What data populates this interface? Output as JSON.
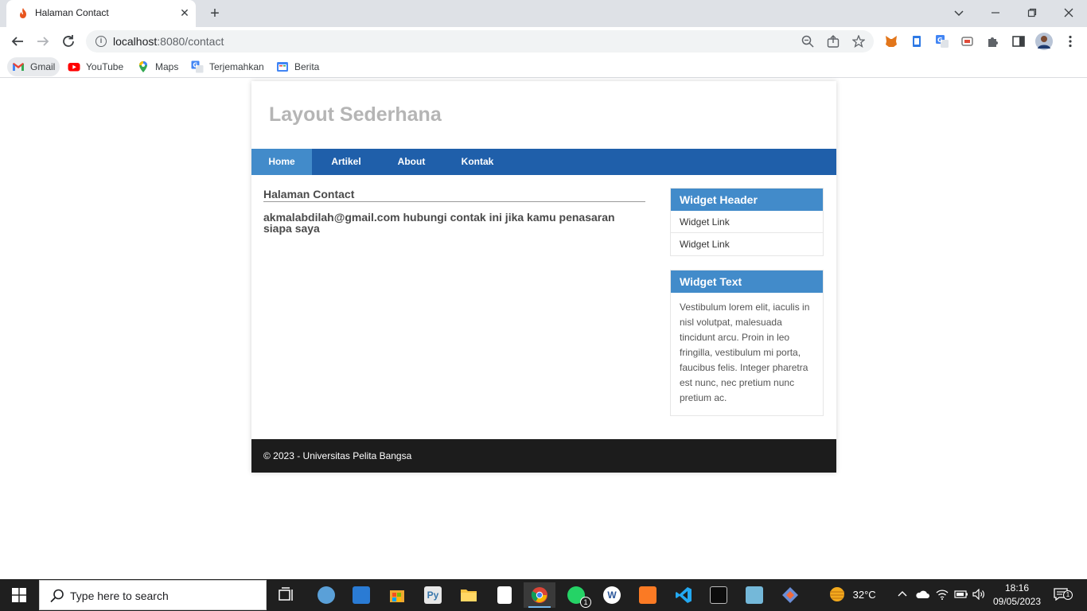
{
  "browser": {
    "tab_title": "Halaman Contact",
    "tab_close": "✕",
    "new_tab": "+",
    "url_host": "localhost",
    "url_rest": ":8080/contact",
    "bookmarks": [
      {
        "label": "Gmail"
      },
      {
        "label": "YouTube"
      },
      {
        "label": "Maps"
      },
      {
        "label": "Terjemahkan"
      },
      {
        "label": "Berita"
      }
    ]
  },
  "site": {
    "title": "Layout Sederhana",
    "nav": [
      {
        "label": "Home",
        "active": true
      },
      {
        "label": "Artikel"
      },
      {
        "label": "About"
      },
      {
        "label": "Kontak"
      }
    ],
    "content": {
      "heading": "Halaman Contact",
      "body": "akmalabdilah@gmail.com hubungi contak ini jika kamu penasaran siapa saya"
    },
    "sidebar": {
      "widget1": {
        "header": "Widget Header",
        "links": [
          "Widget Link",
          "Widget Link"
        ]
      },
      "widget2": {
        "header": "Widget Text",
        "text": "Vestibulum lorem elit, iaculis in nisl volutpat, malesuada tincidunt arcu. Proin in leo fringilla, vestibulum mi porta, faucibus felis. Integer pharetra est nunc, nec pretium nunc pretium ac."
      }
    },
    "footer": "© 2023 - Universitas Pelita Bangsa"
  },
  "taskbar": {
    "search_placeholder": "Type here to search",
    "weather": "32°C",
    "time": "18:16",
    "date": "09/05/2023",
    "whatsapp_badge": "1",
    "notification_badge": "1"
  },
  "colors": {
    "nav_bg": "#1f5faa",
    "nav_active": "#428bca",
    "widget_head": "#428bca",
    "footer_bg": "#1c1c1c",
    "title_gray": "#b5b5b5"
  },
  "icons": {
    "tab": "fire-favicon-icon",
    "nav": [
      "back-arrow-icon",
      "forward-arrow-icon",
      "reload-icon"
    ],
    "omnibox": [
      "info-icon",
      "zoom-out-icon",
      "share-icon",
      "bookmark-star-icon"
    ],
    "extensions": [
      "metamask-icon",
      "clipboard-icon",
      "translate-icon",
      "tab-switch-icon",
      "puzzle-extensions-icon",
      "side-panel-icon",
      "profile-avatar-icon",
      "kebab-menu-icon"
    ]
  }
}
